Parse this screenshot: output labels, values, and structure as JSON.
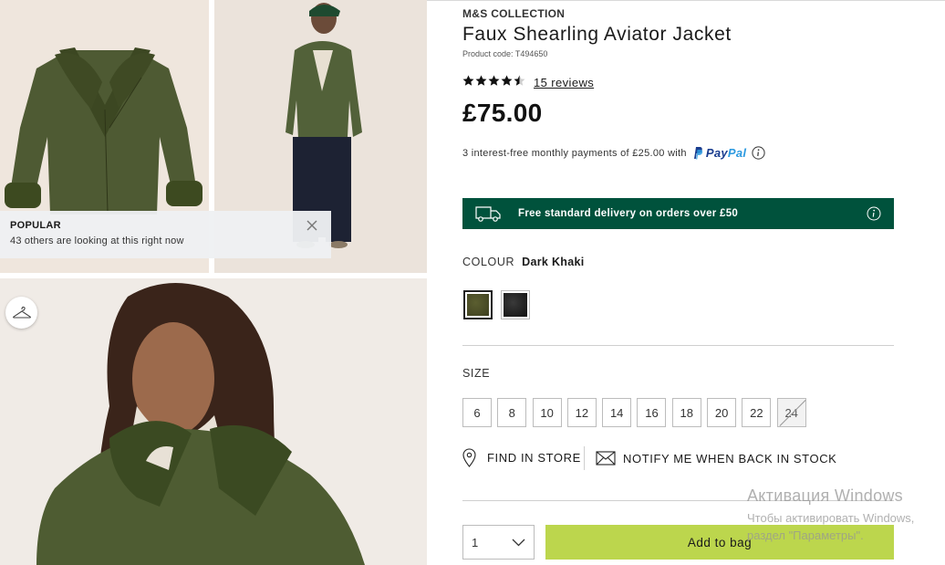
{
  "gallery": {
    "popular": {
      "title": "POPULAR",
      "message": "43 others are looking at this right now"
    }
  },
  "product": {
    "brand": "M&S COLLECTION",
    "title": "Faux Shearling Aviator Jacket",
    "product_code": "Product code: T494650",
    "rating": 4.5,
    "reviews_label": "15 reviews",
    "price": "£75.00",
    "paypal_text": "3 interest-free monthly payments of £25.00 with",
    "paypal_brand_1": "Pay",
    "paypal_brand_2": "Pal",
    "delivery_text": "Free standard delivery on orders over £50",
    "colour": {
      "label": "COLOUR",
      "selected": "Dark Khaki",
      "swatches": [
        {
          "name": "Dark Khaki",
          "color": "#4c4f27",
          "selected": true
        },
        {
          "name": "Black",
          "color": "#1e1e1e",
          "selected": false
        }
      ]
    },
    "size": {
      "label": "SIZE",
      "options": [
        "6",
        "8",
        "10",
        "12",
        "14",
        "16",
        "18",
        "20",
        "22",
        "24"
      ],
      "out_of_stock": [
        "24"
      ]
    },
    "find_in_store": "FIND IN STORE",
    "notify_me": "NOTIFY ME WHEN BACK IN STOCK",
    "quantity": "1",
    "add_to_bag": "Add to bag"
  },
  "colors": {
    "delivery_bg": "#00523c",
    "add_to_bag_bg": "#bcd64d",
    "paypal_dark": "#1a3d8f",
    "paypal_light": "#2d9ae0"
  },
  "watermark": {
    "line1": "Активация Windows",
    "line2": "Чтобы активировать Windows,",
    "line3": "раздел \"Параметры\"."
  }
}
